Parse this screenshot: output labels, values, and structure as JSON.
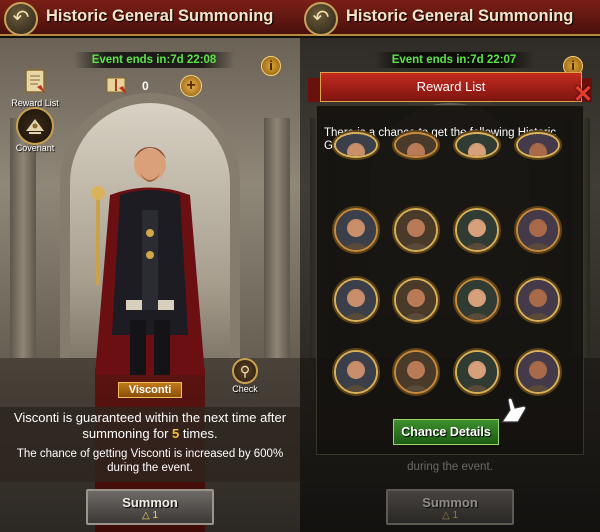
{
  "left": {
    "title": "Historic General Summoning",
    "event": "Event ends in:7d 22:08",
    "reward_list_label": "Reward List",
    "covenant_label": "Covenant",
    "counter": "0",
    "general_name": "Visconti",
    "check_label": "Check",
    "guarantee_pre": "Visconti is guaranteed within the next time after summoning for",
    "guarantee_count": "5",
    "guarantee_post": "times.",
    "chance_text": "The chance of getting Visconti is increased by 600% during the event.",
    "summon_label": "Summon",
    "summon_cost": "1"
  },
  "right": {
    "title": "Historic General Summoning",
    "event": "Event ends in:7d 22:07",
    "reward_list_title": "Reward List",
    "description": "There is a chance to get the following Historic Generals:",
    "chance_details": "Chance Details",
    "chance_text_faded": "during the event.",
    "summon_label": "Summon",
    "summon_cost": "1",
    "portrait_rows": [
      [
        "general-1",
        "general-2",
        "general-3",
        "general-4"
      ],
      [
        "general-5",
        "general-6",
        "general-7",
        "general-8"
      ],
      [
        "general-9",
        "general-10",
        "general-11",
        "general-12"
      ],
      [
        "general-13",
        "general-14",
        "general-15",
        "general-16"
      ]
    ]
  },
  "colors": {
    "header": "#7a1f17",
    "event_text": "#5ee34a",
    "gold": "#d9b25a",
    "button_green": "#3e8f2e"
  },
  "icons": {
    "back": "back-arrow-icon",
    "info": "info-icon",
    "close": "close-icon",
    "plus": "plus-icon",
    "check": "magnifier-icon"
  }
}
